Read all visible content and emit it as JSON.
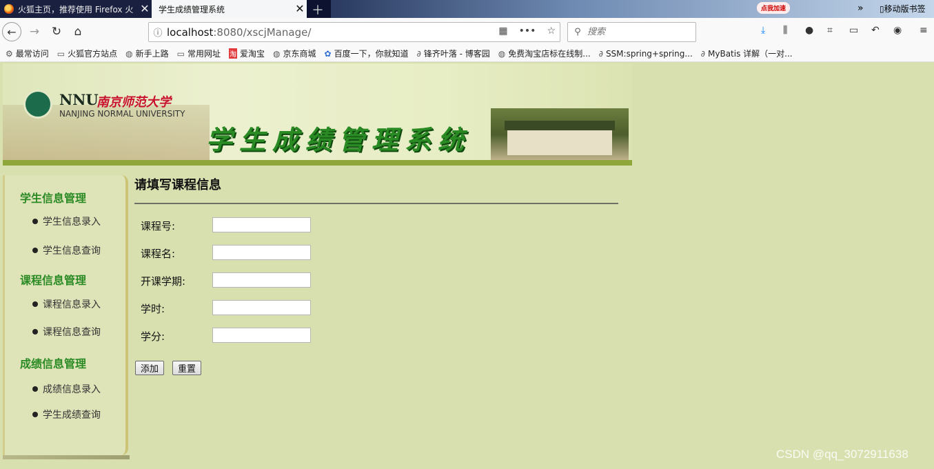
{
  "browser": {
    "tabs": [
      {
        "title": "火狐主页，推荐使用 Firefox 火",
        "active": false
      },
      {
        "title": "学生成绩管理系统",
        "active": true
      }
    ],
    "accelerator_badge": "点我加速",
    "url": {
      "host": "localhost",
      "rest": ":8080/xscjManage/"
    },
    "search_placeholder": "搜索",
    "bookmarks": [
      {
        "icon": "gear-icon",
        "label": "最常访问"
      },
      {
        "icon": "folder-icon",
        "label": "火狐官方站点"
      },
      {
        "icon": "globe-icon",
        "label": "新手上路"
      },
      {
        "icon": "folder-icon",
        "label": "常用网址"
      },
      {
        "icon": "taobao-icon",
        "label": "爱淘宝"
      },
      {
        "icon": "globe-icon",
        "label": "京东商城"
      },
      {
        "icon": "baidu-icon",
        "label": "百度一下，你就知道"
      },
      {
        "icon": "blog-icon",
        "label": "锋齐叶落 - 博客园"
      },
      {
        "icon": "globe-icon",
        "label": "免费淘宝店标在线制..."
      },
      {
        "icon": "blog-icon",
        "label": "SSM:spring+spring..."
      },
      {
        "icon": "blog-icon",
        "label": "MyBatis 详解（一对..."
      }
    ],
    "bookmarks_mobile": "移动版书签"
  },
  "header": {
    "logo_abbr": "NNU",
    "logo_cn": "南京师范大学",
    "logo_en": "NANJING NORMAL UNIVERSITY",
    "system_name": "学生成绩管理系统"
  },
  "sidebar": {
    "sections": [
      {
        "heading": "学生信息管理",
        "items": [
          "学生信息录入",
          "学生信息查询"
        ]
      },
      {
        "heading": "课程信息管理",
        "items": [
          "课程信息录入",
          "课程信息查询"
        ]
      },
      {
        "heading": "成绩信息管理",
        "items": [
          "成绩信息录入",
          "学生成绩查询"
        ]
      }
    ]
  },
  "form": {
    "title": "请填写课程信息",
    "fields": [
      {
        "label": "课程号:",
        "value": ""
      },
      {
        "label": "课程名:",
        "value": ""
      },
      {
        "label": "开课学期:",
        "value": ""
      },
      {
        "label": "学时:",
        "value": ""
      },
      {
        "label": "学分:",
        "value": ""
      }
    ],
    "submit_label": "添加",
    "reset_label": "重置"
  },
  "watermark": "CSDN @qq_3072911638",
  "colors": {
    "page_bg": "#d9e0b0",
    "accent_green": "#2a8a24",
    "banner_stripe": "#8ea63a"
  }
}
